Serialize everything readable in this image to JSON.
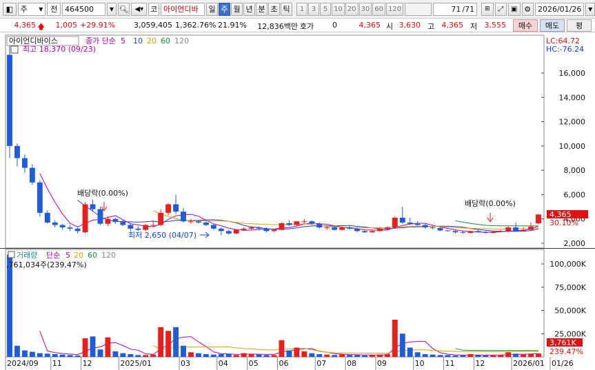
{
  "toolbar": {
    "market_type": "주",
    "period_label": "전",
    "code": "464500",
    "market_flag": "코",
    "stock_name": "아이언디바",
    "period_buttons": [
      "일",
      "주",
      "월",
      "년",
      "분",
      "초",
      "틱"
    ],
    "active_period": "주",
    "interval_buttons": [
      "1",
      "3",
      "5",
      "10",
      "20",
      "30",
      "60",
      "120"
    ],
    "page_current": "71",
    "page_total": "/71",
    "date": "2026/01/26"
  },
  "quote": {
    "price": "4,365",
    "change": "1,005",
    "change_rate": "+29.91%",
    "volume": "3,059,405",
    "volume_rate": "1,362.76%",
    "turnover": "21.91%",
    "amount": "12,836백만",
    "hoga_label": "호가",
    "hoga_value": "0",
    "hoga_price": "4,365",
    "open_label": "시",
    "open": "3,630",
    "high_label": "고",
    "high": "4,365",
    "low_label": "저",
    "low": "3,555",
    "buy_label": "매수",
    "sell_label": "매도",
    "eval_label": "평"
  },
  "price_panel": {
    "title": "아이언디바이스",
    "indicator": "종가 단순",
    "ma_periods": [
      "5",
      "10",
      "20",
      "60",
      "120"
    ],
    "ma_colors": [
      "#b000b0",
      "#2040e0",
      "#e0a000",
      "#1a8a3a",
      "#888888"
    ],
    "max_note": "최고 18,370 (09/23)",
    "min_note": "최저 2,650 (04/07)",
    "lc": "LC:64.72",
    "hc": "HC:-76.24",
    "y_ticks": [
      "16,000",
      "14,000",
      "12,000",
      "10,000",
      "8,000",
      "6,000",
      "4,000",
      "2,000"
    ],
    "price_tag": "4,365",
    "pct_tag": "30.10%",
    "dividend_label_1": "배당락(0.00%)",
    "dividend_label_2": "배당락(0.00%)"
  },
  "volume_panel": {
    "title": "거래량",
    "indicator": "단순",
    "ma_periods": [
      "5",
      "20",
      "60",
      "120"
    ],
    "max_note": ",761,034주(239,47%)",
    "y_ticks": [
      "100,000K",
      "75,000K",
      "50,000K",
      "25,000K"
    ],
    "vol_tag": "3,761K",
    "pct_tag": "239.47%"
  },
  "x_axis": [
    "2024/09",
    "11",
    "12",
    "2025/01",
    "03",
    "04",
    "05",
    "06",
    "07",
    "08",
    "09",
    "10",
    "11",
    "12",
    "2026/01",
    "01/26"
  ],
  "colors": {
    "up": "#e8201c",
    "down": "#1f5cd8",
    "axis": "#444444",
    "grid": "#dddddd"
  },
  "chart_data": {
    "type": "candlestick",
    "x": [
      "2024-09-23",
      "2024-09-30",
      "2024-10-07",
      "2024-10-14",
      "2024-10-21",
      "2024-10-28",
      "2024-11-04",
      "2024-11-11",
      "2024-11-18",
      "2024-11-25",
      "2024-12-02",
      "2024-12-09",
      "2024-12-16",
      "2024-12-23",
      "2024-12-30",
      "2025-01-06",
      "2025-01-13",
      "2025-01-20",
      "2025-01-27",
      "2025-02-03",
      "2025-02-10",
      "2025-02-17",
      "2025-02-24",
      "2025-03-03",
      "2025-03-10",
      "2025-03-17",
      "2025-03-24",
      "2025-03-31",
      "2025-04-07",
      "2025-04-14",
      "2025-04-21",
      "2025-04-28",
      "2025-05-05",
      "2025-05-12",
      "2025-05-19",
      "2025-05-26",
      "2025-06-02",
      "2025-06-09",
      "2025-06-16",
      "2025-06-23",
      "2025-06-30",
      "2025-07-07",
      "2025-07-14",
      "2025-07-21",
      "2025-07-28",
      "2025-08-04",
      "2025-08-11",
      "2025-08-18",
      "2025-08-25",
      "2025-09-01",
      "2025-09-08",
      "2025-09-15",
      "2025-09-22",
      "2025-09-29",
      "2025-10-06",
      "2025-10-13",
      "2025-10-20",
      "2025-10-27",
      "2025-11-03",
      "2025-11-10",
      "2025-11-17",
      "2025-11-24",
      "2025-12-01",
      "2025-12-08",
      "2025-12-15",
      "2025-12-22",
      "2025-12-29",
      "2026-01-05",
      "2026-01-12",
      "2026-01-19",
      "2026-01-26"
    ],
    "open": [
      17500,
      10000,
      9000,
      8200,
      7000,
      4500,
      3700,
      3500,
      3300,
      3200,
      2900,
      5200,
      4800,
      3600,
      4000,
      3750,
      3500,
      3200,
      3100,
      3500,
      3500,
      4500,
      5200,
      4600,
      3800,
      3800,
      3700,
      3500,
      3200,
      3000,
      2800,
      3100,
      3200,
      3300,
      3200,
      3000,
      3100,
      3650,
      3500,
      3800,
      3800,
      3600,
      3300,
      3300,
      3100,
      3300,
      3200,
      3000,
      2900,
      3000,
      3200,
      3300,
      4100,
      3700,
      3600,
      3500,
      3300,
      3250,
      3050,
      3000,
      2900,
      2850,
      3000,
      2900,
      2850,
      2950,
      3000,
      3300,
      3000,
      3100,
      3630
    ],
    "high": [
      18370,
      10200,
      9300,
      8500,
      7200,
      4700,
      3900,
      3600,
      3500,
      3300,
      5400,
      5600,
      5000,
      4200,
      4100,
      3950,
      3600,
      3400,
      3600,
      3900,
      4800,
      5300,
      6000,
      4900,
      4000,
      3900,
      3800,
      3600,
      3300,
      3100,
      3150,
      3300,
      3400,
      3400,
      3300,
      3200,
      3700,
      3900,
      3800,
      4000,
      3900,
      3700,
      3400,
      3400,
      3400,
      3400,
      3300,
      3100,
      3100,
      3300,
      3400,
      4200,
      5000,
      4100,
      3800,
      3600,
      3400,
      3300,
      3100,
      3100,
      3000,
      3050,
      3100,
      3000,
      3050,
      3100,
      3400,
      3700,
      3300,
      3700,
      4365
    ],
    "low": [
      9000,
      8300,
      7800,
      6800,
      4200,
      3600,
      3300,
      3100,
      3000,
      2800,
      2800,
      4600,
      3500,
      3400,
      3600,
      3400,
      3000,
      3000,
      3000,
      3300,
      3400,
      4300,
      4400,
      3700,
      3600,
      3600,
      3400,
      3100,
      2650,
      2700,
      2750,
      3000,
      3100,
      3100,
      2900,
      2900,
      3050,
      3400,
      3400,
      3600,
      3500,
      3200,
      3100,
      3050,
      3050,
      3100,
      2900,
      2850,
      2850,
      2950,
      3100,
      3200,
      3600,
      3500,
      3400,
      3200,
      3150,
      3000,
      2950,
      2800,
      2800,
      2800,
      2850,
      2800,
      2800,
      2900,
      2900,
      2950,
      2950,
      3050,
      3555
    ],
    "close": [
      10000,
      9000,
      8200,
      7000,
      4500,
      3700,
      3500,
      3300,
      3200,
      3000,
      5200,
      4800,
      3600,
      4000,
      3750,
      3500,
      3200,
      3100,
      3500,
      3500,
      4500,
      5200,
      4600,
      3800,
      3800,
      3700,
      3500,
      3200,
      3000,
      2800,
      3100,
      3200,
      3300,
      3200,
      3000,
      3100,
      3650,
      3500,
      3800,
      3800,
      3600,
      3300,
      3300,
      3100,
      3300,
      3200,
      3000,
      2900,
      3000,
      3200,
      3300,
      4100,
      3700,
      3600,
      3500,
      3300,
      3250,
      3050,
      3000,
      2900,
      2850,
      3000,
      2900,
      2850,
      2950,
      3000,
      3300,
      3000,
      3100,
      3360,
      4365
    ],
    "volume_k": [
      110000,
      12000,
      7000,
      5500,
      4000,
      3500,
      3000,
      2500,
      2000,
      1500,
      20000,
      22000,
      8000,
      21000,
      6000,
      4000,
      3000,
      2000,
      2000,
      2500,
      32000,
      28000,
      32000,
      12000,
      5000,
      4000,
      3000,
      2500,
      3000,
      3000,
      2000,
      4000,
      3000,
      2500,
      2000,
      2000,
      18000,
      7000,
      10000,
      6000,
      4000,
      3000,
      2500,
      2000,
      3000,
      2000,
      2000,
      1500,
      2000,
      2500,
      3000,
      40000,
      25000,
      10000,
      5000,
      3000,
      2500,
      2000,
      2000,
      1500,
      1500,
      3000,
      2000,
      1500,
      1500,
      2000,
      5000,
      3500,
      2500,
      3000,
      3761
    ]
  }
}
